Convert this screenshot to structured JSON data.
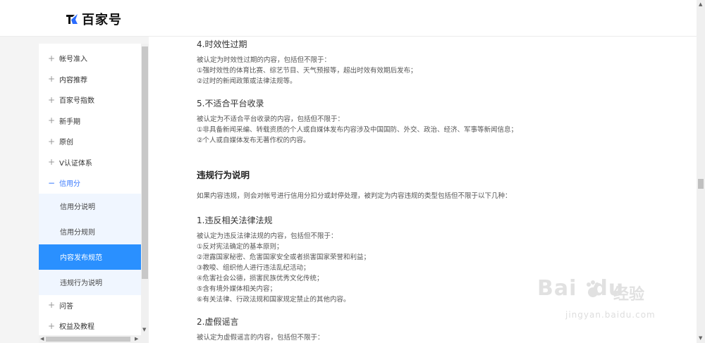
{
  "header": {
    "logo_text": "百家号"
  },
  "sidebar": {
    "items": [
      {
        "label": "帐号准入",
        "toggle": "+"
      },
      {
        "label": "内容推荐",
        "toggle": "+"
      },
      {
        "label": "百家号指数",
        "toggle": "+"
      },
      {
        "label": "新手期",
        "toggle": "+"
      },
      {
        "label": "原创",
        "toggle": "+"
      },
      {
        "label": "V认证体系",
        "toggle": "+"
      },
      {
        "label": "信用分",
        "toggle": "−"
      }
    ],
    "sub_items": [
      {
        "label": "信用分说明"
      },
      {
        "label": "信用分规则"
      },
      {
        "label": "内容发布规范"
      },
      {
        "label": "违规行为说明"
      }
    ],
    "bottom_items": [
      {
        "label": "问答",
        "toggle": "+"
      },
      {
        "label": "权益及教程",
        "toggle": "+"
      }
    ]
  },
  "content": {
    "s4": {
      "title": "4.时效性过期",
      "lines": [
        "被认定为时效性过期的内容，包括但不限于：",
        "①强时效性的体育比赛、综艺节目、天气预报等，超出时效有效期后发布；",
        "②过时的新闻政策或法律法规等。"
      ]
    },
    "s5": {
      "title": "5.不适合平台收录",
      "lines": [
        "被认定为不适合平台收录的内容，包括但不限于：",
        "①非具备新闻采编、转载资质的个人或自媒体发布内容涉及中国国防、外交、政治、经济、军事等新闻信息；",
        "②个人或自媒体发布无著作权的内容。"
      ]
    },
    "violation": {
      "title": "违规行为说明",
      "intro": "如果内容违规，则会对帐号进行信用分扣分或封停处理，被判定为内容违规的类型包括但不限于以下几种："
    },
    "v1": {
      "title": "1.违反相关法律法规",
      "lines": [
        "被认定为违反法律法规的内容，包括但不限于：",
        "①反对宪法确定的基本原则；",
        "②泄露国家秘密、危害国家安全或者损害国家荣誉和利益；",
        "③教唆、组织他人进行违法乱纪活动；",
        "④危害社会公德，损害民族优秀文化传统；",
        "⑤含有境外媒体相关内容；",
        "⑥有关法律、行政法规和国家规定禁止的其他内容。"
      ]
    },
    "v2": {
      "title": "2.虚假谣言",
      "lines": [
        "被认定为虚假谣言的内容，包括但不限于："
      ]
    }
  },
  "watermark": {
    "brand": "Bai",
    "brand2": "du",
    "cn": "经验",
    "url": "jingyan.baidu.com"
  },
  "colors": {
    "accent": "#2a90ff",
    "link": "#3a7afe",
    "sub_bg": "#f0f6ff"
  }
}
